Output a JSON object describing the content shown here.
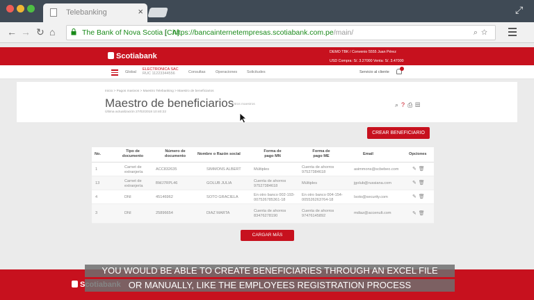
{
  "browser": {
    "tab_title": "Telebanking",
    "tab_close": "×",
    "url_org": "The Bank of Nova Scotia [CA]",
    "url_sep": "|",
    "url_domain": "https://bancainternetempresas.scotiabank.com.pe",
    "url_path": "/main/",
    "nav_icons": [
      "back-icon",
      "forward-icon",
      "reload-icon",
      "home-icon"
    ]
  },
  "header": {
    "logo": "Scotiabank",
    "user_line": "DEMO TBK / Convenio 5555   Juan Pérez",
    "rate_line": "USD Compra: S/. 3.27000 Venta: S/. 3.47000"
  },
  "nav": {
    "global": "Global",
    "company": "ELECTRONICA SAC",
    "ruc": "RUC 11223344556",
    "items": [
      "Consultas",
      "Operaciones",
      "Solicitudes"
    ],
    "service": "Servicio al cliente",
    "badge": "12"
  },
  "page": {
    "breadcrumb": "Inicio  >  Pagos masivos  >  Maestro Telebanking  >  Maestro de beneficiarios",
    "title": "Maestro de beneficiarios",
    "other_masters": "Otros maestros",
    "updated": "Última actualización 27/02/2018 10:40:22",
    "create_button": "CREAR BENEFICIARIO",
    "more_button": "CARGAR MÁS"
  },
  "table": {
    "headers": [
      "No.",
      "Tipo de documento",
      "Número de documento",
      "Nombre o Razón social",
      "Forma de pago MN",
      "Forma de pago ME",
      "Email",
      "Opciones"
    ],
    "rows": [
      {
        "no": "1",
        "tipo": "Carnet de extranjería",
        "numero": "ACC832635",
        "nombre": "SIMMONS ALBERT",
        "mn": "Múltiples",
        "me": "Cuenta de ahorros 97527384618",
        "email": "asimmons@scbebeo.com"
      },
      {
        "no": "13",
        "tipo": "Carnet de extranjería",
        "numero": "BMJ7RPL46",
        "nombre": "GOLUB JULIA",
        "mn": "Cuenta de ahorros 97527384618",
        "me": "Múltiples",
        "email": "jgolub@russiana.com"
      },
      {
        "no": "4",
        "tipo": "DNI",
        "numero": "45146962",
        "nombre": "SOTO GRACIELA",
        "mn": "En otro banco 002-193-007526785361-18",
        "me": "En otro banco 004-154-005526263764-18",
        "email": "Isoto@security.com"
      },
      {
        "no": "3",
        "tipo": "DNI",
        "numero": "25896654",
        "nombre": "DIAZ MARTA",
        "mn": "Cuenta de ahorros 83476278190",
        "me": "Cuenta de ahorros 97476145892",
        "email": "mdiaz@accenult.com"
      }
    ]
  },
  "captions": {
    "line1": "YOU WOULD BE ABLE TO CREATE BENEFICIARIES THROUGH AN EXCEL FILE",
    "line2": "OR MANUALLY, LIKE THE EMPLOYEES REGISTRATION PROCESS"
  },
  "colors": {
    "brand": "#c7111e",
    "chrome": "#3f4a55"
  }
}
